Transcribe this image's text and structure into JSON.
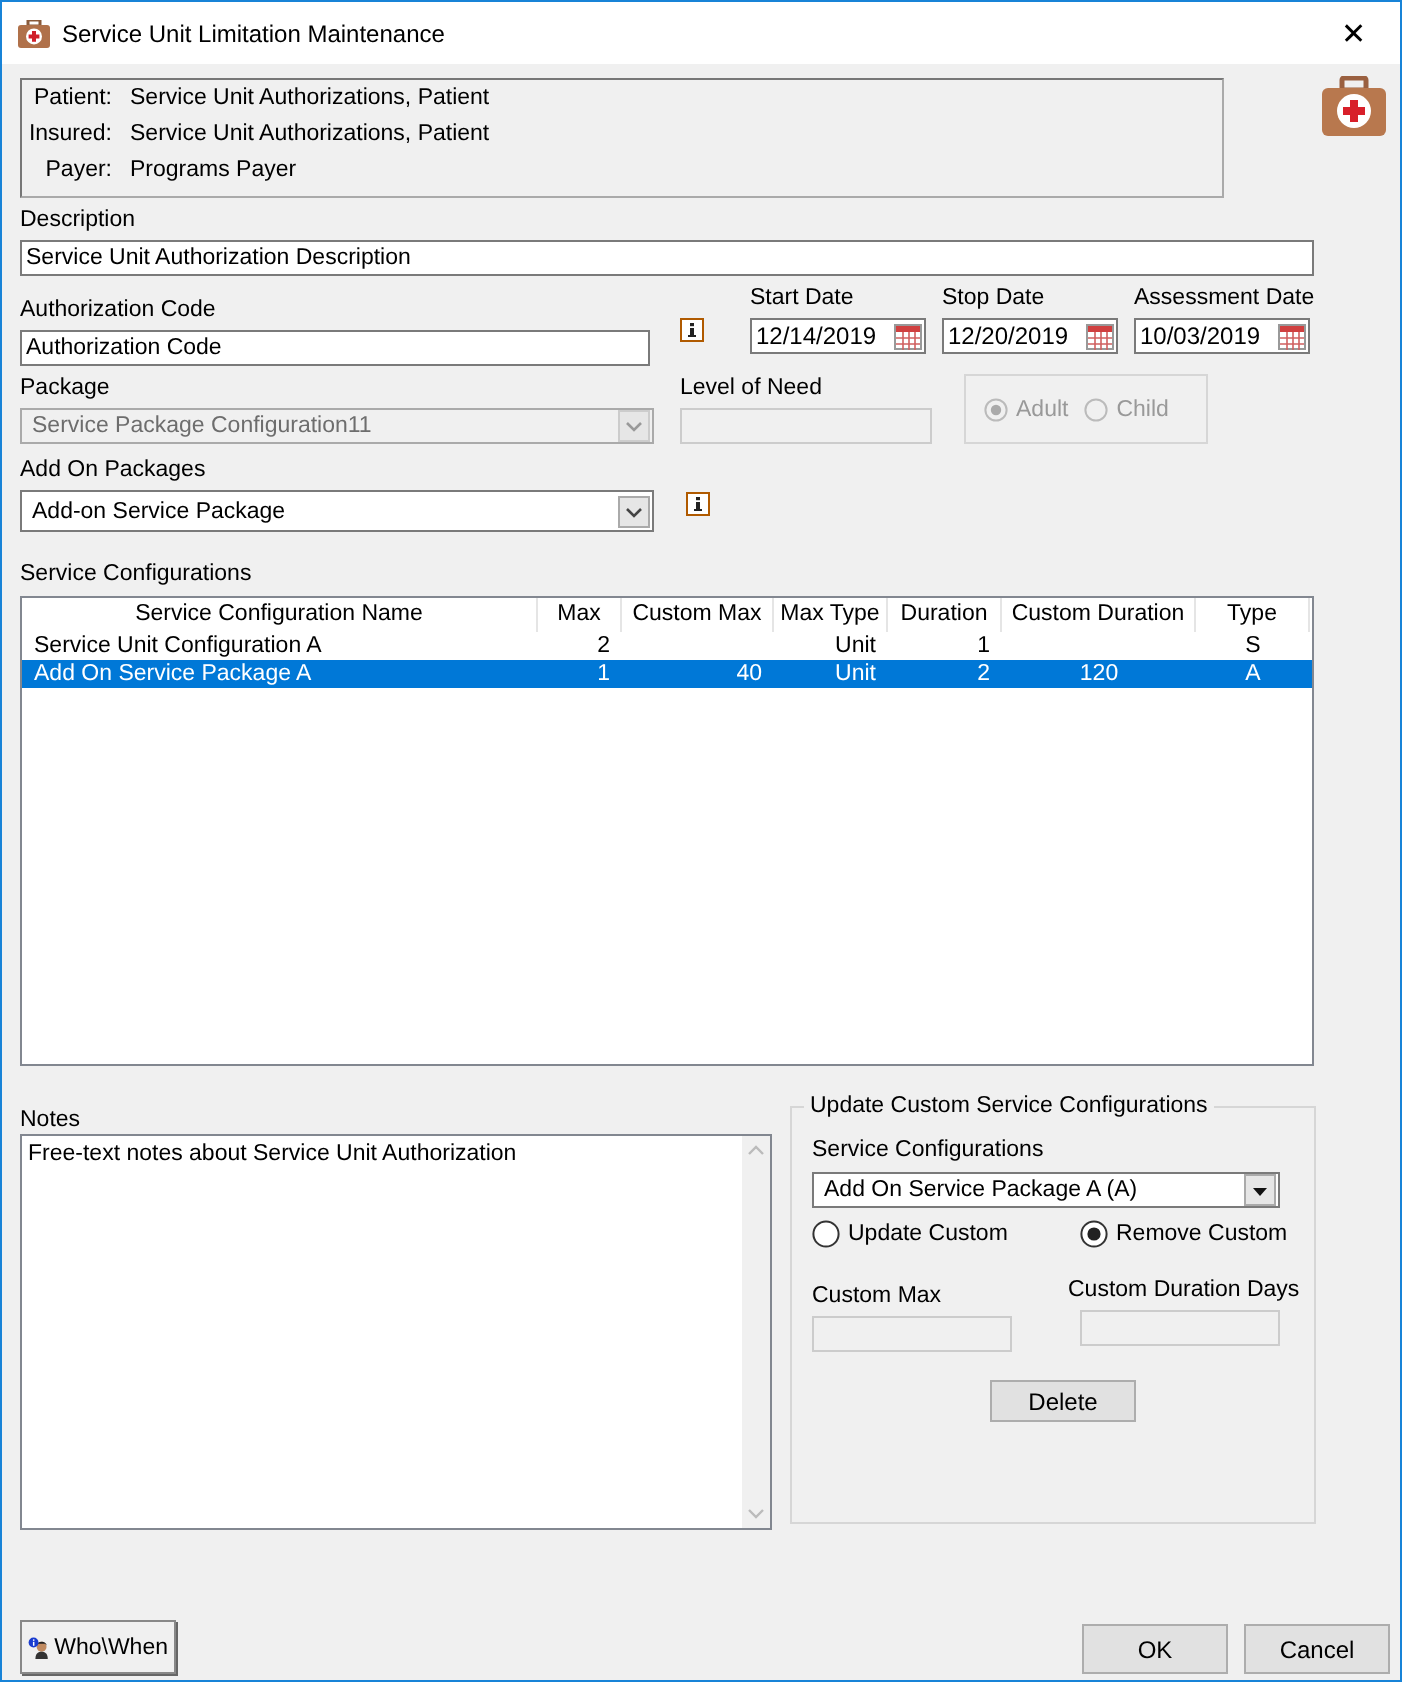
{
  "window": {
    "title": "Service Unit Limitation Maintenance",
    "close": "✕"
  },
  "header": [
    {
      "label": "Patient:",
      "value": "Service Unit Authorizations, Patient"
    },
    {
      "label": "Insured:",
      "value": "Service Unit Authorizations, Patient"
    },
    {
      "label": "Payer:",
      "value": "Programs Payer"
    }
  ],
  "description": {
    "label": "Description",
    "value": "Service Unit Authorization Description"
  },
  "authorization_code": {
    "label": "Authorization Code",
    "value": "Authorization Code"
  },
  "dates": [
    {
      "label": "Start Date",
      "value": "12/14/2019"
    },
    {
      "label": "Stop Date",
      "value": "12/20/2019"
    },
    {
      "label": "Assessment Date",
      "value": "10/03/2019"
    }
  ],
  "package": {
    "label": "Package",
    "value": "Service Package Configuration11",
    "disabled": true
  },
  "level_of_need": {
    "label": "Level of Need",
    "disabled": true
  },
  "age_group": [
    {
      "label": "Adult",
      "selected": true,
      "disabled": true
    },
    {
      "label": "Child",
      "selected": false,
      "disabled": true
    }
  ],
  "add_on_packages": {
    "label": "Add On Packages",
    "value": "Add-on Service Package",
    "disabled": false
  },
  "service_configurations": {
    "label": "Service Configurations",
    "columns": [
      "Service Configuration Name",
      "Max",
      "Custom Max",
      "Max Type",
      "Duration",
      "Custom Duration",
      "Type"
    ],
    "rows": [
      {
        "cells": [
          "Service Unit Configuration A",
          "2",
          null,
          "Unit",
          "1",
          null,
          "S"
        ],
        "selected": false
      },
      {
        "cells": [
          "Add On Service Package A",
          "1",
          "40",
          "Unit",
          "2",
          "120",
          "A"
        ],
        "selected": true
      }
    ]
  },
  "notes": {
    "label": "Notes",
    "value": "Free-text notes about Service Unit Authorization"
  },
  "update_custom": {
    "title": "Update Custom Service Configurations",
    "select_label": "Service Configurations",
    "select_value": "Add On Service Package A (A)",
    "options": [
      {
        "label": "Update Custom",
        "selected": false
      },
      {
        "label": "Remove Custom",
        "selected": true
      }
    ],
    "custom_max": {
      "label": "Custom Max",
      "disabled": true
    },
    "custom_duration": {
      "label": "Custom Duration Days",
      "disabled": true
    },
    "delete_button": "Delete"
  },
  "footer": {
    "who_when": "Who\\When",
    "ok": "OK",
    "cancel": "Cancel"
  }
}
